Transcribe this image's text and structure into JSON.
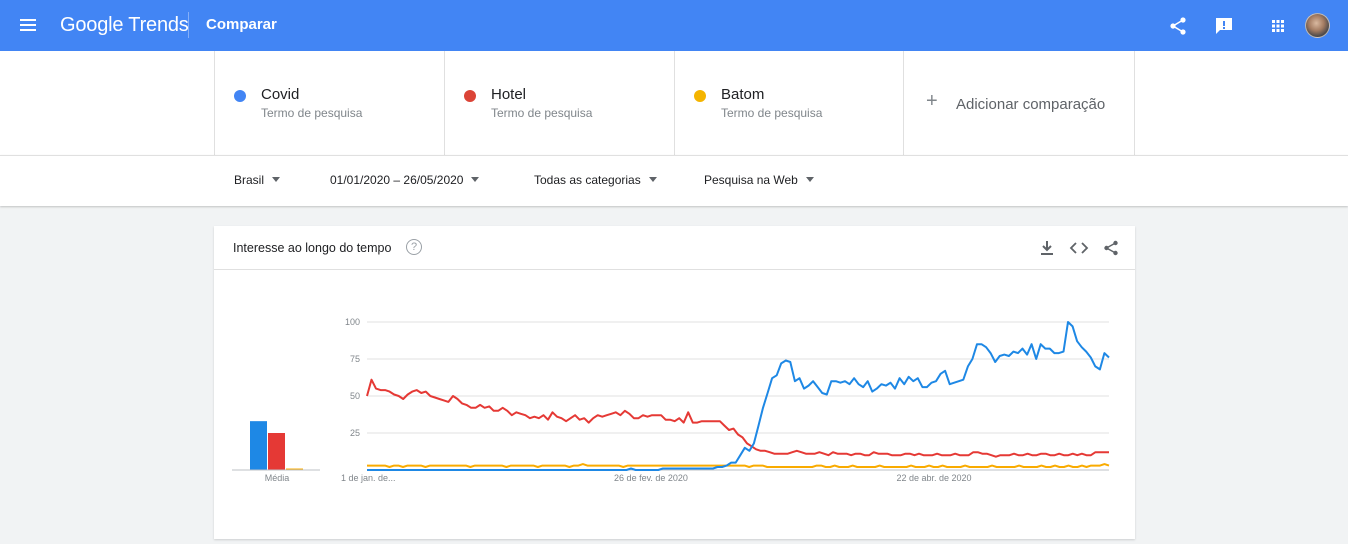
{
  "header": {
    "logo_google": "Google",
    "logo_trends": "Trends",
    "page_title": "Comparar"
  },
  "terms": [
    {
      "name": "Covid",
      "subtitle": "Termo de pesquisa",
      "color": "#4285f4"
    },
    {
      "name": "Hotel",
      "subtitle": "Termo de pesquisa",
      "color": "#db4437"
    },
    {
      "name": "Batom",
      "subtitle": "Termo de pesquisa",
      "color": "#f4b400"
    }
  ],
  "add_comparison": {
    "plus": "+",
    "label": "Adicionar comparação"
  },
  "filters": {
    "region": "Brasil",
    "date_range": "01/01/2020 – 26/05/2020",
    "category": "Todas as categorias",
    "search_type": "Pesquisa na Web"
  },
  "card": {
    "title": "Interesse ao longo do tempo",
    "help": "?"
  },
  "chart_data": {
    "type": "line",
    "title": "Interesse ao longo do tempo",
    "ylim": [
      0,
      100
    ],
    "yticks": [
      100,
      75,
      50,
      25
    ],
    "xticks": [
      "1 de jan. de...",
      "26 de fev. de 2020",
      "22 de abr. de 2020"
    ],
    "average_label": "Média",
    "averages": [
      33,
      25,
      1
    ],
    "grid": true,
    "series": [
      {
        "name": "Covid",
        "color": "#1e88e5",
        "values": [
          0,
          0,
          0,
          0,
          0,
          0,
          0,
          0,
          0,
          0,
          0,
          0,
          0,
          0,
          0,
          0,
          0,
          0,
          0,
          0,
          0,
          0,
          0,
          0,
          0,
          0,
          0,
          0,
          0,
          0,
          0,
          0,
          0,
          0,
          0,
          0,
          0,
          0,
          0,
          0,
          0,
          0,
          0,
          0,
          0,
          0,
          0,
          0,
          0,
          0,
          0,
          0,
          0,
          0,
          0,
          0,
          0,
          0,
          1,
          0,
          0,
          0,
          0,
          0,
          0,
          1,
          1,
          1,
          1,
          1,
          1,
          1,
          1,
          1,
          1,
          1,
          1,
          2,
          2,
          3,
          5,
          5,
          10,
          15,
          13,
          18,
          30,
          42,
          52,
          62,
          64,
          72,
          74,
          73,
          60,
          62,
          55,
          57,
          60,
          56,
          52,
          51,
          60,
          60,
          59,
          60,
          58,
          62,
          58,
          56,
          60,
          53,
          55,
          58,
          57,
          59,
          55,
          62,
          58,
          63,
          60,
          62,
          56,
          56,
          59,
          60,
          65,
          67,
          58,
          59,
          60,
          61,
          70,
          75,
          85,
          85,
          83,
          79,
          73,
          77,
          78,
          77,
          80,
          79,
          82,
          78,
          85,
          75,
          85,
          82,
          82,
          79,
          79,
          80,
          100,
          97,
          87,
          83,
          80,
          76,
          70,
          68,
          79,
          76
        ]
      },
      {
        "name": "Hotel",
        "color": "#e53935",
        "values": [
          50,
          61,
          55,
          54,
          54,
          53,
          51,
          50,
          48,
          51,
          53,
          54,
          52,
          53,
          50,
          49,
          48,
          47,
          46,
          50,
          48,
          45,
          44,
          42,
          42,
          44,
          42,
          43,
          40,
          40,
          42,
          40,
          37,
          39,
          38,
          37,
          35,
          36,
          35,
          37,
          34,
          39,
          36,
          35,
          33,
          35,
          37,
          34,
          35,
          32,
          35,
          37,
          36,
          37,
          38,
          39,
          37,
          40,
          38,
          35,
          35,
          37,
          36,
          37,
          37,
          37,
          34,
          34,
          33,
          35,
          32,
          39,
          32,
          32,
          33,
          33,
          33,
          33,
          33,
          30,
          27,
          28,
          24,
          22,
          18,
          16,
          14,
          13,
          13,
          12,
          11,
          11,
          11,
          11,
          12,
          13,
          12,
          11,
          11,
          11,
          12,
          11,
          10,
          12,
          11,
          11,
          11,
          10,
          11,
          11,
          10,
          10,
          12,
          11,
          11,
          11,
          10,
          10,
          10,
          11,
          11,
          10,
          11,
          10,
          10,
          10,
          11,
          10,
          10,
          10,
          11,
          10,
          10,
          10,
          12,
          12,
          11,
          11,
          10,
          9,
          10,
          10,
          10,
          11,
          10,
          10,
          11,
          10,
          10,
          11,
          11,
          10,
          10,
          11,
          10,
          10,
          11,
          10,
          11,
          10,
          10,
          12,
          12,
          12,
          12
        ]
      },
      {
        "name": "Batom",
        "color": "#f9ab00",
        "values": [
          3,
          3,
          3,
          3,
          3,
          2,
          3,
          3,
          2,
          3,
          3,
          3,
          3,
          2,
          3,
          3,
          3,
          3,
          3,
          3,
          3,
          3,
          3,
          2,
          3,
          3,
          3,
          3,
          3,
          3,
          3,
          2,
          3,
          3,
          3,
          3,
          3,
          3,
          2,
          3,
          3,
          3,
          3,
          3,
          3,
          2,
          3,
          3,
          4,
          3,
          3,
          3,
          3,
          3,
          3,
          3,
          3,
          2,
          3,
          3,
          3,
          3,
          3,
          3,
          3,
          3,
          3,
          3,
          3,
          3,
          3,
          3,
          3,
          3,
          3,
          3,
          3,
          3,
          3,
          3,
          3,
          3,
          3,
          3,
          3,
          2,
          3,
          3,
          3,
          2,
          2,
          2,
          2,
          2,
          2,
          2,
          2,
          2,
          2,
          2,
          3,
          3,
          2,
          2,
          3,
          2,
          2,
          2,
          3,
          2,
          2,
          2,
          2,
          2,
          3,
          2,
          2,
          2,
          2,
          2,
          2,
          3,
          2,
          2,
          2,
          3,
          2,
          2,
          3,
          2,
          2,
          2,
          2,
          3,
          2,
          2,
          2,
          2,
          2,
          3,
          2,
          2,
          2,
          2,
          2,
          3,
          2,
          2,
          2,
          2,
          3,
          2,
          2,
          3,
          2,
          2,
          3,
          2,
          2,
          3,
          2,
          3,
          3,
          3,
          4,
          3
        ]
      }
    ]
  }
}
